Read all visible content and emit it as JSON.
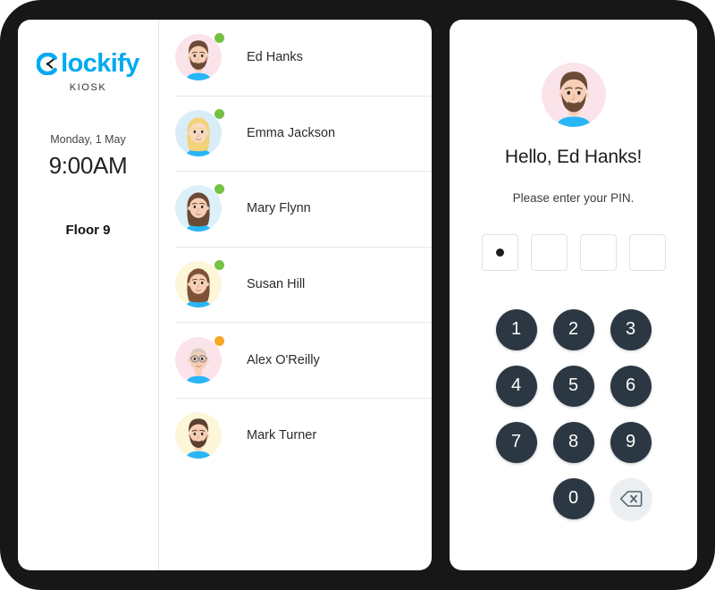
{
  "sidebar": {
    "logo_word": "lockify",
    "logo_mark_icon": "clockify-clock-icon",
    "subtitle": "KIOSK",
    "date": "Monday, 1 May",
    "time": "9:00AM",
    "location": "Floor 9"
  },
  "user_list": {
    "users": [
      {
        "name": "Ed Hanks",
        "status": "online",
        "status_color": "#76c043",
        "avatar_bg": "#fbe3ea",
        "avatar_icon": "avatar-ed-hanks"
      },
      {
        "name": "Emma Jackson",
        "status": "online",
        "status_color": "#76c043",
        "avatar_bg": "#d9edf8",
        "avatar_icon": "avatar-emma-jackson"
      },
      {
        "name": "Mary Flynn",
        "status": "online",
        "status_color": "#76c043",
        "avatar_bg": "#dcf0f9",
        "avatar_icon": "avatar-mary-flynn"
      },
      {
        "name": "Susan Hill",
        "status": "online",
        "status_color": "#76c043",
        "avatar_bg": "#fdf6d8",
        "avatar_icon": "avatar-susan-hill"
      },
      {
        "name": "Alex O'Reilly",
        "status": "away",
        "status_color": "#f6a623",
        "avatar_bg": "#fbe3ea",
        "avatar_icon": "avatar-alex-oreilly"
      },
      {
        "name": "Mark Turner",
        "status": "offline",
        "status_color": "",
        "avatar_bg": "#fdf6d8",
        "avatar_icon": "avatar-mark-turner"
      }
    ]
  },
  "pin_panel": {
    "avatar_icon": "avatar-ed-hanks",
    "greeting": "Hello, Ed Hanks!",
    "prompt": "Please enter your PIN.",
    "pin_length": 4,
    "pin_filled": 1,
    "keys": [
      "1",
      "2",
      "3",
      "4",
      "5",
      "6",
      "7",
      "8",
      "9"
    ],
    "zero_key": "0",
    "backspace_icon": "backspace-icon"
  },
  "colors": {
    "brand": "#03a9f4",
    "key_bg": "#2b3742",
    "backspace_bg": "#eceff1",
    "online": "#76c043",
    "away": "#f6a623",
    "divider": "#e3e8ec",
    "bezel": "#171717"
  }
}
